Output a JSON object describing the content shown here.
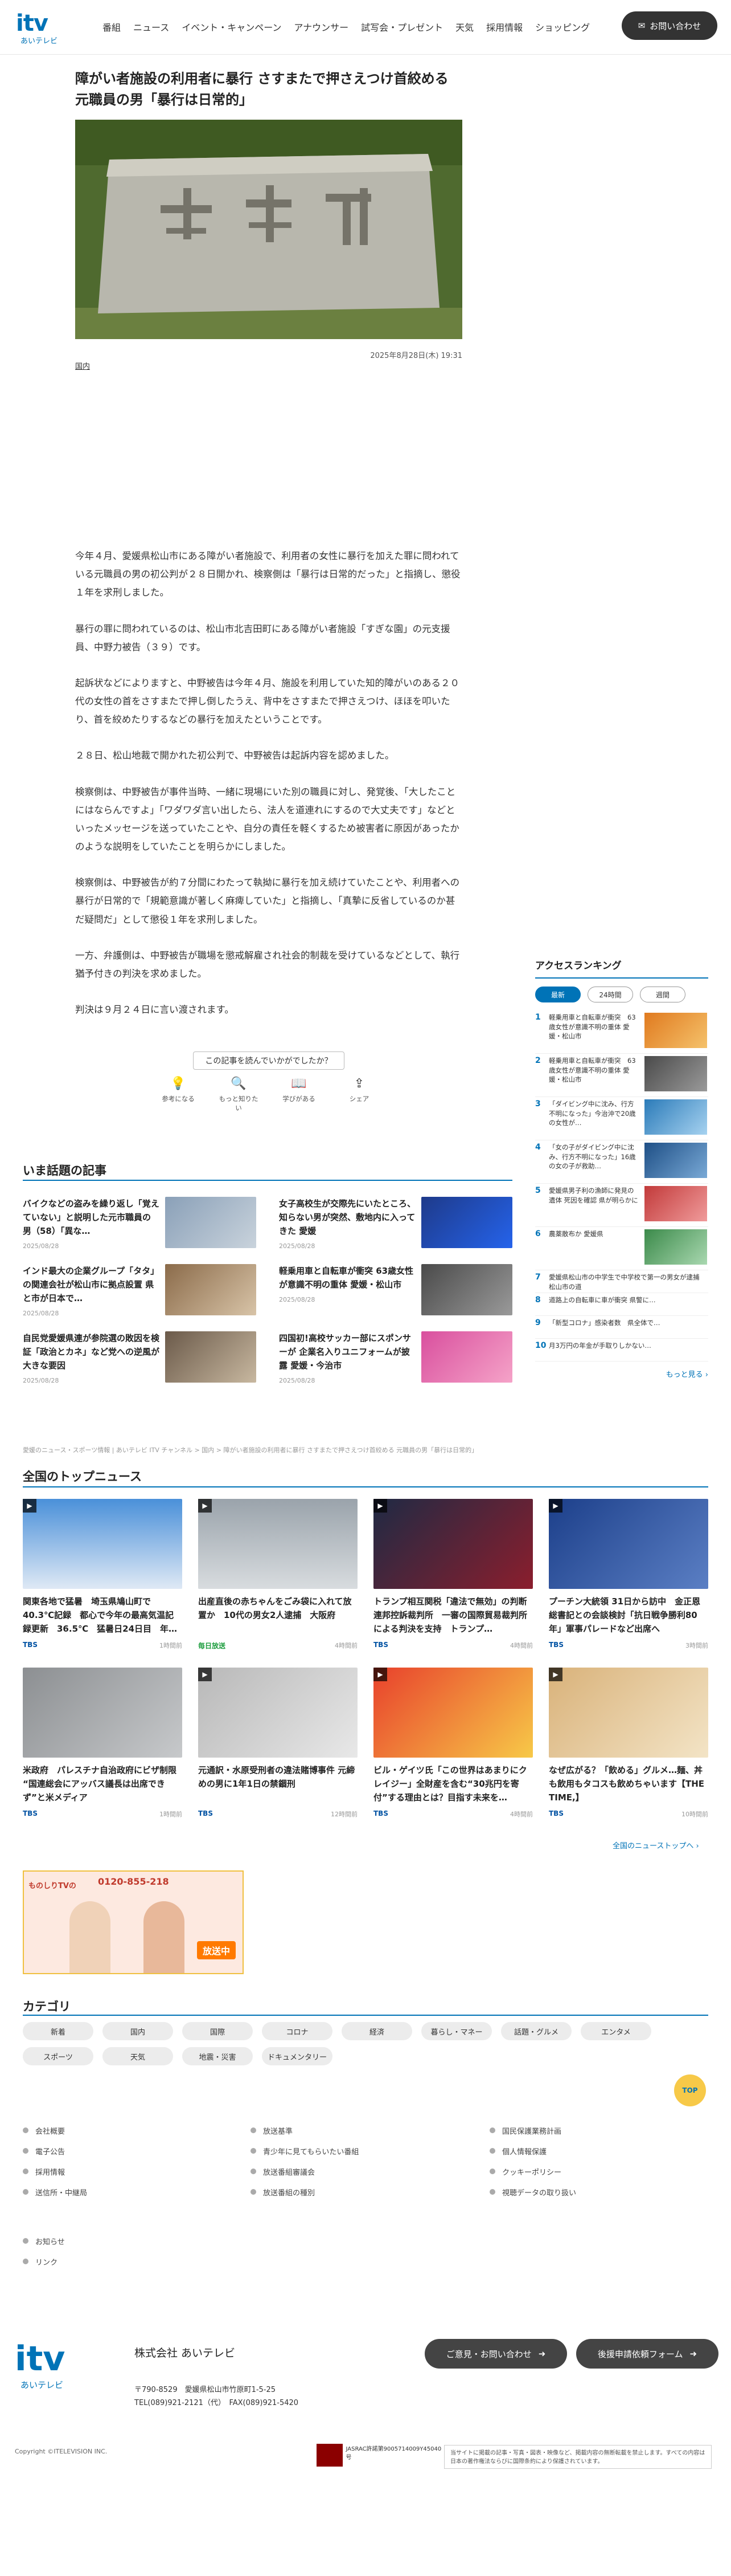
{
  "header": {
    "logo_text": "itv",
    "logo_sub": "あいテレビ",
    "nav": [
      "番組",
      "ニュース",
      "イベント・キャンペーン",
      "アナウンサー",
      "試写会・プレゼント",
      "天気",
      "採用情報",
      "ショッピング"
    ],
    "contact": "お問い合わせ"
  },
  "article": {
    "title": "障がい者施設の利用者に暴行 さすまたで押さえつけ首絞める 元職員の男「暴行は日常的」",
    "date": "2025年8月28日(木) 19:31",
    "category": "国内",
    "paragraphs": [
      "今年４月、愛媛県松山市にある障がい者施設で、利用者の女性に暴行を加えた罪に問われている元職員の男の初公判が２８日開かれ、検察側は「暴行は日常的だった」と指摘し、懲役１年を求刑しました。",
      "暴行の罪に問われているのは、松山市北吉田町にある障がい者施設「すぎな園」の元支援員、中野力被告（３９）です。",
      "起訴状などによりますと、中野被告は今年４月、施設を利用していた知的障がいのある２０代の女性の首をさすまたで押し倒したうえ、背中をさすまたで押さえつけ、ほほを叩いたり、首を絞めたりするなどの暴行を加えたということです。",
      "２８日、松山地裁で開かれた初公判で、中野被告は起訴内容を認めました。",
      "検察側は、中野被告が事件当時、一緒に現場にいた別の職員に対し、発覚後、「大したことにはならんですよ」「ワダワダ言い出したら、法人を道連れにするので大丈夫です」などといったメッセージを送っていたことや、自分の責任を軽くするため被害者に原因があったかのような説明をしていたことを明らかにしました。",
      "検察側は、中野被告が約７分間にわたって執拗に暴行を加え続けていたことや、利用者への暴行が日常的で「規範意識が著しく麻痺していた」と指摘し、「真摯に反省しているのか甚だ疑問だ」として懲役１年を求刑しました。",
      "一方、弁護側は、中野被告が職場を懲戒解雇され社会的制裁を受けているなどとして、執行猶予付きの判決を求めました。",
      "判決は９月２４日に言い渡されます。"
    ]
  },
  "feedback": {
    "question": "この記事を読んでいかがでしたか？",
    "options": [
      "参考になる",
      "もっと知りたい",
      "学びがある",
      "シェア"
    ]
  },
  "trending": {
    "heading": "いま話題の記事",
    "items": [
      {
        "title": "バイクなどの盗みを繰り返し「覚えていない」と説明した元市職員の男（58）「異な…",
        "date": "2025/08/28"
      },
      {
        "title": "女子高校生が交際先にいたところ、知らない男が突然、敷地内に入ってきた 愛媛",
        "date": "2025/08/28"
      },
      {
        "title": "インド最大の企業グループ「タタ」の関連会社が松山市に拠点設置 県と市が日本で…",
        "date": "2025/08/28"
      },
      {
        "title": "軽乗用車と自転車が衝突 63歳女性が意識不明の重体 愛媛・松山市",
        "date": "2025/08/28"
      },
      {
        "title": "自民党愛媛県連が参院選の敗因を検証「政治とカネ」など党への逆風が大きな要因",
        "date": "2025/08/28"
      },
      {
        "title": "四国初!高校サッカー部にスポンサーが 企業名入りユニフォームが披露 愛媛・今治市",
        "date": "2025/08/28"
      }
    ]
  },
  "breadcrumb": "愛媛のニュース・スポーツ情報 | あいテレビ ITV チャンネル > 国内 > 障がい者施設の利用者に暴行 さすまたで押さえつけ首絞める 元職員の男「暴行は日常的」",
  "top_news": {
    "heading": "全国のトップニュース",
    "more": "全国のニューストップへ ›",
    "items": [
      {
        "title": "関東各地で猛暑　埼玉県鳩山町で40.3℃記録　都心で今年の最高気温記録更新　36.5℃　猛暑日24日目　年…",
        "src": "TBS",
        "ago": "1時間前"
      },
      {
        "title": "出産直後の赤ちゃんをごみ袋に入れて放置か　10代の男女2人逮捕　大阪府",
        "src": "毎日放送",
        "ago": "4時間前"
      },
      {
        "title": "トランプ相互関税「違法で無効」の判断　連邦控訴裁判所　一審の国際貿易裁判所による判決を支持　トランプ…",
        "src": "TBS",
        "ago": "4時間前"
      },
      {
        "title": "プーチン大統領 31日から訪中　金正恩総書記との会談検討「抗日戦争勝利80年」軍事パレードなど出席へ",
        "src": "TBS",
        "ago": "3時間前"
      },
      {
        "title": "米政府　パレスチナ自治政府にビザ制限 “国連総会にアッバス議長は出席できず”と米メディア",
        "src": "TBS",
        "ago": "1時間前"
      },
      {
        "title": "元通訳・水原受刑者の違法賭博事件 元締めの男に1年1日の禁錮刑",
        "src": "TBS",
        "ago": "12時間前"
      },
      {
        "title": "ビル・ゲイツ氏「この世界はあまりにクレイジー」全財産を含む“30兆円を寄付”する理由とは？目指す未来を…",
        "src": "TBS",
        "ago": "4時間前"
      },
      {
        "title": "なぜ広がる？「飲める」グルメ…麺、丼も飲用もタコスも飲めちゃいます【THE TIME,】",
        "src": "TBS",
        "ago": "10時間前"
      }
    ]
  },
  "banner": {
    "tag": "ものしりTVの",
    "phone": "0120-855-218",
    "live": "放送中"
  },
  "categories": {
    "heading": "カテゴリ",
    "items": [
      "新着",
      "国内",
      "国際",
      "コロナ",
      "経済",
      "暮らし・マネー",
      "話題・グルメ",
      "エンタメ",
      "スポーツ",
      "天気",
      "地震・災害",
      "ドキュメンタリー"
    ]
  },
  "ranking": {
    "heading": "アクセスランキング",
    "tabs": [
      "最新",
      "24時間",
      "週間"
    ],
    "items": [
      "軽乗用車と自転車が衝突　63歳女性が意識不明の重体 愛媛・松山市",
      "軽乗用車と自転車が衝突　63歳女性が意識不明の重体 愛媛・松山市",
      "「ダイビング中に沈み、行方不明になった」今治沖で20歳の女性が…",
      "「女の子がダイビング中に沈み、行方不明になった」16歳の女の子が救助…",
      "愛媛県男子利の漁師に発見の遺体 死因を確認 県が明らかに",
      "農薬散布か 愛媛県",
      "愛媛県松山市の中学生で中学校で第一の男女が逮捕 松山市の道",
      "道路上の自転車に車が衝突 県警に…",
      "「新型コロナ」感染者数　県全体で…",
      "月3万円の年金が手取りしかない…"
    ],
    "more": "もっと見る ›"
  },
  "footer": {
    "col1": [
      "会社概要",
      "電子公告",
      "採用情報",
      "送信所・中継局"
    ],
    "col2": [
      "放送基準",
      "青少年に見てもらいたい番組",
      "放送番組審議会",
      "放送番組の種別"
    ],
    "col3": [
      "国民保護業務計画",
      "個人情報保護",
      "クッキーポリシー",
      "視聴データの取り扱い"
    ],
    "col4": [
      "お知らせ",
      "リンク"
    ],
    "corp_name": "株式会社 あいテレビ",
    "address": "〒790-8529　愛媛県松山市竹原町1-5-25",
    "tel": "TEL(089)921-2121（代）　FAX(089)921-5420",
    "btn1": "ご意見・お問い合わせ",
    "btn2": "後援申請依頼フォーム",
    "copyright": "Copyright ©ITELEVISION INC.",
    "jasrac": "JASRAC許諾第9005714009Y45040号",
    "notice": "当サイトに掲載の記事・写真・図表・映像など、掲載内容の無断転載を禁止します。すべての内容は日本の著作権法ならびに国際条約により保護されています。",
    "top": "TOP"
  }
}
